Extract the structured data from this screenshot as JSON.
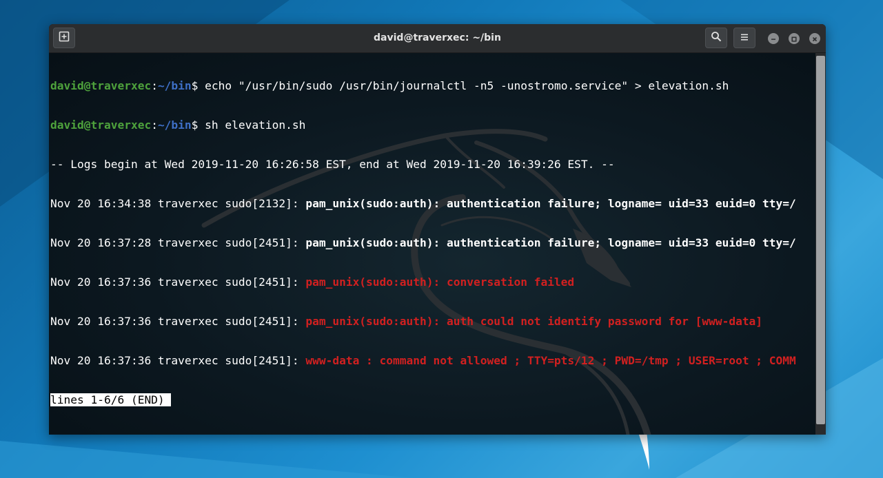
{
  "window": {
    "title": "david@traverxec: ~/bin",
    "buttons": {
      "new_tab_icon": "new-tab-icon",
      "search_icon": "search-icon",
      "menu_icon": "hamburger-menu-icon",
      "minimize_icon": "minimize-icon",
      "maximize_icon": "maximize-icon",
      "close_icon": "close-icon"
    }
  },
  "terminal": {
    "prompt_user": "david@traverxec",
    "prompt_sep": ":",
    "prompt_path": "~/bin",
    "prompt_sign": "$",
    "cmd1": " echo \"/usr/bin/sudo /usr/bin/journalctl -n5 -unostromo.service\" > elevation.sh",
    "cmd2": " sh elevation.sh",
    "log_header": "-- Logs begin at Wed 2019-11-20 16:26:58 EST, end at Wed 2019-11-20 16:39:26 EST. --",
    "log1_prefix": "Nov 20 16:34:38 traverxec sudo[2132]: ",
    "log1_msg": "pam_unix(sudo:auth): authentication failure; logname= uid=33 euid=0 tty=/",
    "log2_prefix": "Nov 20 16:37:28 traverxec sudo[2451]: ",
    "log2_msg": "pam_unix(sudo:auth): authentication failure; logname= uid=33 euid=0 tty=/",
    "log3_prefix": "Nov 20 16:37:36 traverxec sudo[2451]: ",
    "log3_msg": "pam_unix(sudo:auth): conversation failed",
    "log4_prefix": "Nov 20 16:37:36 traverxec sudo[2451]: ",
    "log4_msg": "pam_unix(sudo:auth): auth could not identify password for [www-data]",
    "log5_prefix": "Nov 20 16:37:36 traverxec sudo[2451]: ",
    "log5_msg": "www-data : command not allowed ; TTY=pts/12 ; PWD=/tmp ; USER=root ; COMM",
    "pager_status": "lines 1-6/6 (END) "
  },
  "colors": {
    "prompt_user": "#4ea23c",
    "prompt_path": "#3e6fc6",
    "error_text": "#d12020",
    "desktop_blue": "#1178b8"
  }
}
